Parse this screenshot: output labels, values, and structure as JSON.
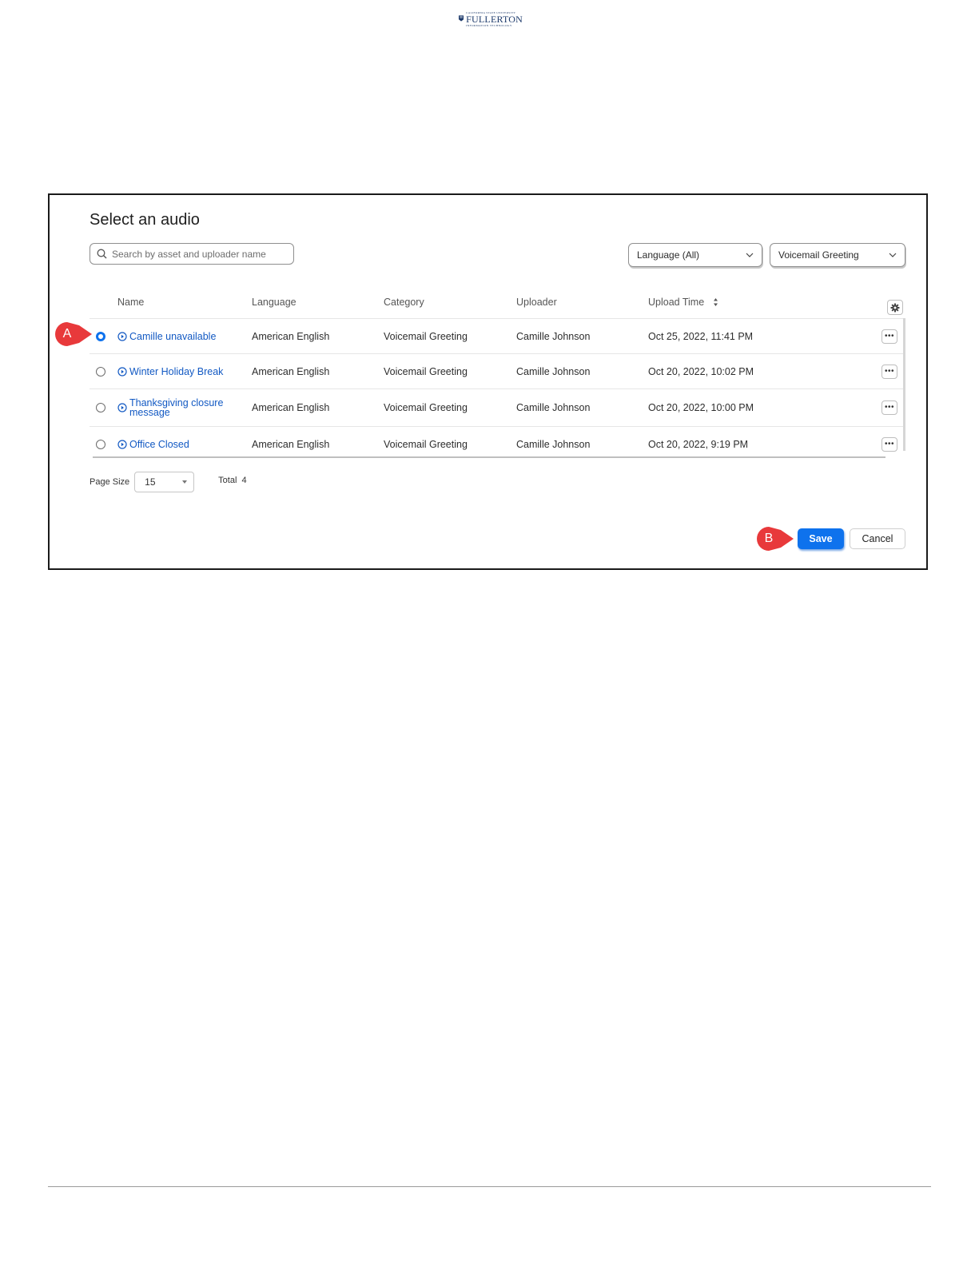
{
  "logo": {
    "top_text": "CALIFORNIA STATE UNIVERSITY",
    "main_text": "FULLERTON",
    "bottom_text": "INFORMATION TECHNOLOGY"
  },
  "dialog": {
    "title": "Select an audio",
    "search": {
      "placeholder": "Search by asset and uploader name",
      "value": ""
    },
    "filters": {
      "language": "Language (All)",
      "category": "Voicemail Greeting"
    },
    "columns": [
      "Name",
      "Language",
      "Category",
      "Uploader",
      "Upload Time"
    ],
    "rows": [
      {
        "selected": true,
        "name": "Camille unavailable",
        "language": "American English",
        "category": "Voicemail Greeting",
        "uploader": "Camille Johnson",
        "upload_time": "Oct 25, 2022, 11:41 PM"
      },
      {
        "selected": false,
        "name": "Winter Holiday Break",
        "language": "American English",
        "category": "Voicemail Greeting",
        "uploader": "Camille Johnson",
        "upload_time": "Oct 20, 2022, 10:02 PM"
      },
      {
        "selected": false,
        "name": "Thanksgiving closure message",
        "language": "American English",
        "category": "Voicemail Greeting",
        "uploader": "Camille Johnson",
        "upload_time": "Oct 20, 2022, 10:00 PM"
      },
      {
        "selected": false,
        "name": "Office Closed",
        "language": "American English",
        "category": "Voicemail Greeting",
        "uploader": "Camille Johnson",
        "upload_time": "Oct 20, 2022, 9:19 PM"
      }
    ],
    "page_size_label": "Page Size",
    "page_size_value": "15",
    "total_label": "Total",
    "total_value": "4",
    "save_label": "Save",
    "cancel_label": "Cancel"
  },
  "callouts": {
    "a": "A",
    "b": "B",
    "color": "#e8393b"
  },
  "colors": {
    "accent": "#0e72ed",
    "link": "#1259c3"
  }
}
